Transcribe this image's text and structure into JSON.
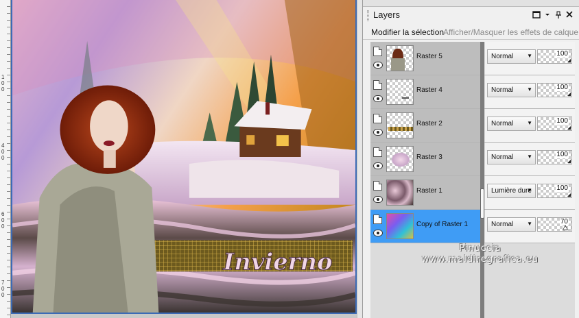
{
  "canvas": {
    "ruler_marks": [
      "1",
      "0",
      "0",
      "2",
      "0",
      "0",
      "3",
      "0",
      "0",
      "4",
      "0",
      "0",
      "5",
      "0",
      "0",
      "6",
      "0",
      "0",
      "7",
      "0",
      "0"
    ],
    "art_title": "Invierno"
  },
  "panel": {
    "title": "Layers",
    "toolbar": {
      "modify_selection": "Modifier la sélection",
      "toggle_effects": "Afficher/Masquer les effets de calque"
    },
    "layers": [
      {
        "name": "Raster 5",
        "blend": "Normal",
        "opacity": "100",
        "selected": false
      },
      {
        "name": "Raster 4",
        "blend": "Normal",
        "opacity": "100",
        "selected": false
      },
      {
        "name": "Raster 2",
        "blend": "Normal",
        "opacity": "100",
        "selected": false
      },
      {
        "name": "Raster 3",
        "blend": "Normal",
        "opacity": "100",
        "selected": false
      },
      {
        "name": "Raster 1",
        "blend": "Lumière dure",
        "opacity": "100",
        "selected": false
      },
      {
        "name": "Copy of Raster 1",
        "blend": "Normal",
        "opacity": "70",
        "selected": true
      }
    ]
  },
  "watermark": {
    "line1": "Pinuccia",
    "line2": "www.maldiregrafica.eu"
  },
  "colors": {
    "selection": "#3f9cf5",
    "frame": "#3c6bb5"
  }
}
